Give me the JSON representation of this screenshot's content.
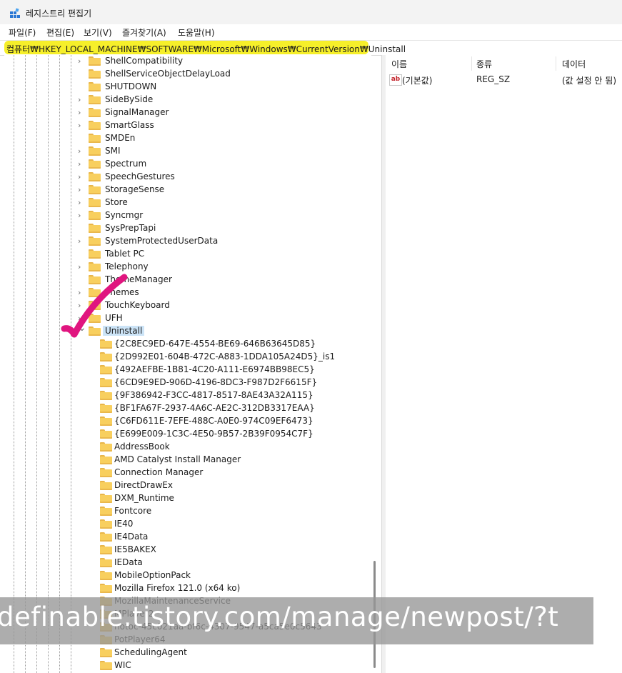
{
  "window": {
    "title": "레지스트리 편집기"
  },
  "menu": [
    {
      "label": "파일(F)"
    },
    {
      "label": "편집(E)"
    },
    {
      "label": "보기(V)"
    },
    {
      "label": "즐겨찾기(A)"
    },
    {
      "label": "도움말(H)"
    }
  ],
  "address": {
    "path": "컴퓨터₩HKEY_LOCAL_MACHINE₩SOFTWARE₩Microsoft₩Windows₩CurrentVersion₩Uninstall",
    "highlight_color": "#f6ef2a"
  },
  "tree": {
    "parent_keys": [
      {
        "label": "ShellCompatibility",
        "expandable": true
      },
      {
        "label": "ShellServiceObjectDelayLoad",
        "expandable": false
      },
      {
        "label": "SHUTDOWN",
        "expandable": false
      },
      {
        "label": "SideBySide",
        "expandable": true
      },
      {
        "label": "SignalManager",
        "expandable": true
      },
      {
        "label": "SmartGlass",
        "expandable": true
      },
      {
        "label": "SMDEn",
        "expandable": false
      },
      {
        "label": "SMI",
        "expandable": true
      },
      {
        "label": "Spectrum",
        "expandable": true
      },
      {
        "label": "SpeechGestures",
        "expandable": true
      },
      {
        "label": "StorageSense",
        "expandable": true
      },
      {
        "label": "Store",
        "expandable": true
      },
      {
        "label": "Syncmgr",
        "expandable": true
      },
      {
        "label": "SysPrepTapi",
        "expandable": false
      },
      {
        "label": "SystemProtectedUserData",
        "expandable": true
      },
      {
        "label": "Tablet PC",
        "expandable": false
      },
      {
        "label": "Telephony",
        "expandable": true
      },
      {
        "label": "ThemeManager",
        "expandable": false
      },
      {
        "label": "Themes",
        "expandable": true
      },
      {
        "label": "TouchKeyboard",
        "expandable": true
      },
      {
        "label": "UFH",
        "expandable": true
      },
      {
        "label": "Uninstall",
        "expandable": true,
        "expanded": true,
        "selected": true
      }
    ],
    "child_keys": [
      "{2C8EC9ED-647E-4554-BE69-646B63645D85}",
      "{2D992E01-604B-472C-A883-1DDA105A24D5}_is1",
      "{492AEFBE-1B81-4C20-A111-E6974BB98EC5}",
      "{6CD9E9ED-906D-4196-8DC3-F987D2F6615F}",
      "{9F386942-F3CC-4817-8517-8AE43A32A115}",
      "{BF1FA67F-2937-4A6C-AE2C-312DB3317EAA}",
      "{C6FD611E-7EFE-488C-A0E0-974C09EF6473}",
      "{E699E009-1C3C-4E50-9B57-2B39F0954C7F}",
      "AddressBook",
      "AMD Catalyst Install Manager",
      "Connection Manager",
      "DirectDrawEx",
      "DXM_Runtime",
      "Fontcore",
      "IE40",
      "IE4Data",
      "IE5BAKEX",
      "IEData",
      "MobileOptionPack",
      "Mozilla Firefox 121.0 (x64 ko)",
      "MozillaMaintenanceService",
      "MPlayer2",
      "notoc-45c021aa-bf6c-4307-9547-a5ca5e0c5643",
      "PotPlayer64",
      "SchedulingAgent",
      "WIC"
    ]
  },
  "values_pane": {
    "columns": [
      "이름",
      "종류",
      "데이터"
    ],
    "rows": [
      {
        "name": "(기본값)",
        "type": "REG_SZ",
        "data": "(값 설정 안 됨)",
        "icon": "string-value-icon"
      }
    ]
  },
  "annotation": {
    "checkmark_color": "#e0157f"
  },
  "watermark": {
    "text": "definable.tistory.com/manage/newpost/?t"
  }
}
